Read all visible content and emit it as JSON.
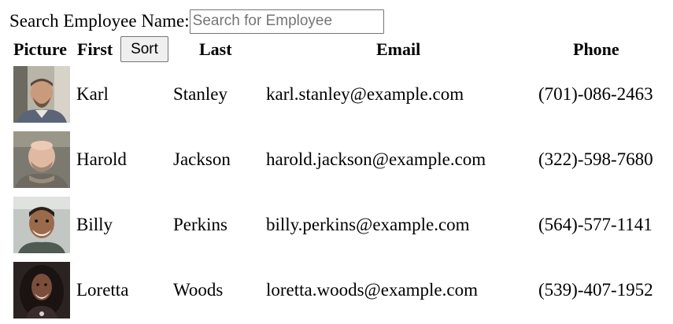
{
  "search": {
    "label": "Search Employee Name:",
    "placeholder": "Search for Employee",
    "value": ""
  },
  "table": {
    "headers": {
      "picture": "Picture",
      "first": "First",
      "sort_button": "Sort",
      "last": "Last",
      "email": "Email",
      "phone": "Phone"
    },
    "rows": [
      {
        "picture": "employee-photo-karl",
        "first": "Karl",
        "last": "Stanley",
        "email": "karl.stanley@example.com",
        "phone": "(701)-086-2463"
      },
      {
        "picture": "employee-photo-harold",
        "first": "Harold",
        "last": "Jackson",
        "email": "harold.jackson@example.com",
        "phone": "(322)-598-7680"
      },
      {
        "picture": "employee-photo-billy",
        "first": "Billy",
        "last": "Perkins",
        "email": "billy.perkins@example.com",
        "phone": "(564)-577-1141"
      },
      {
        "picture": "employee-photo-loretta",
        "first": "Loretta",
        "last": "Woods",
        "email": "loretta.woods@example.com",
        "phone": "(539)-407-1952"
      }
    ]
  }
}
